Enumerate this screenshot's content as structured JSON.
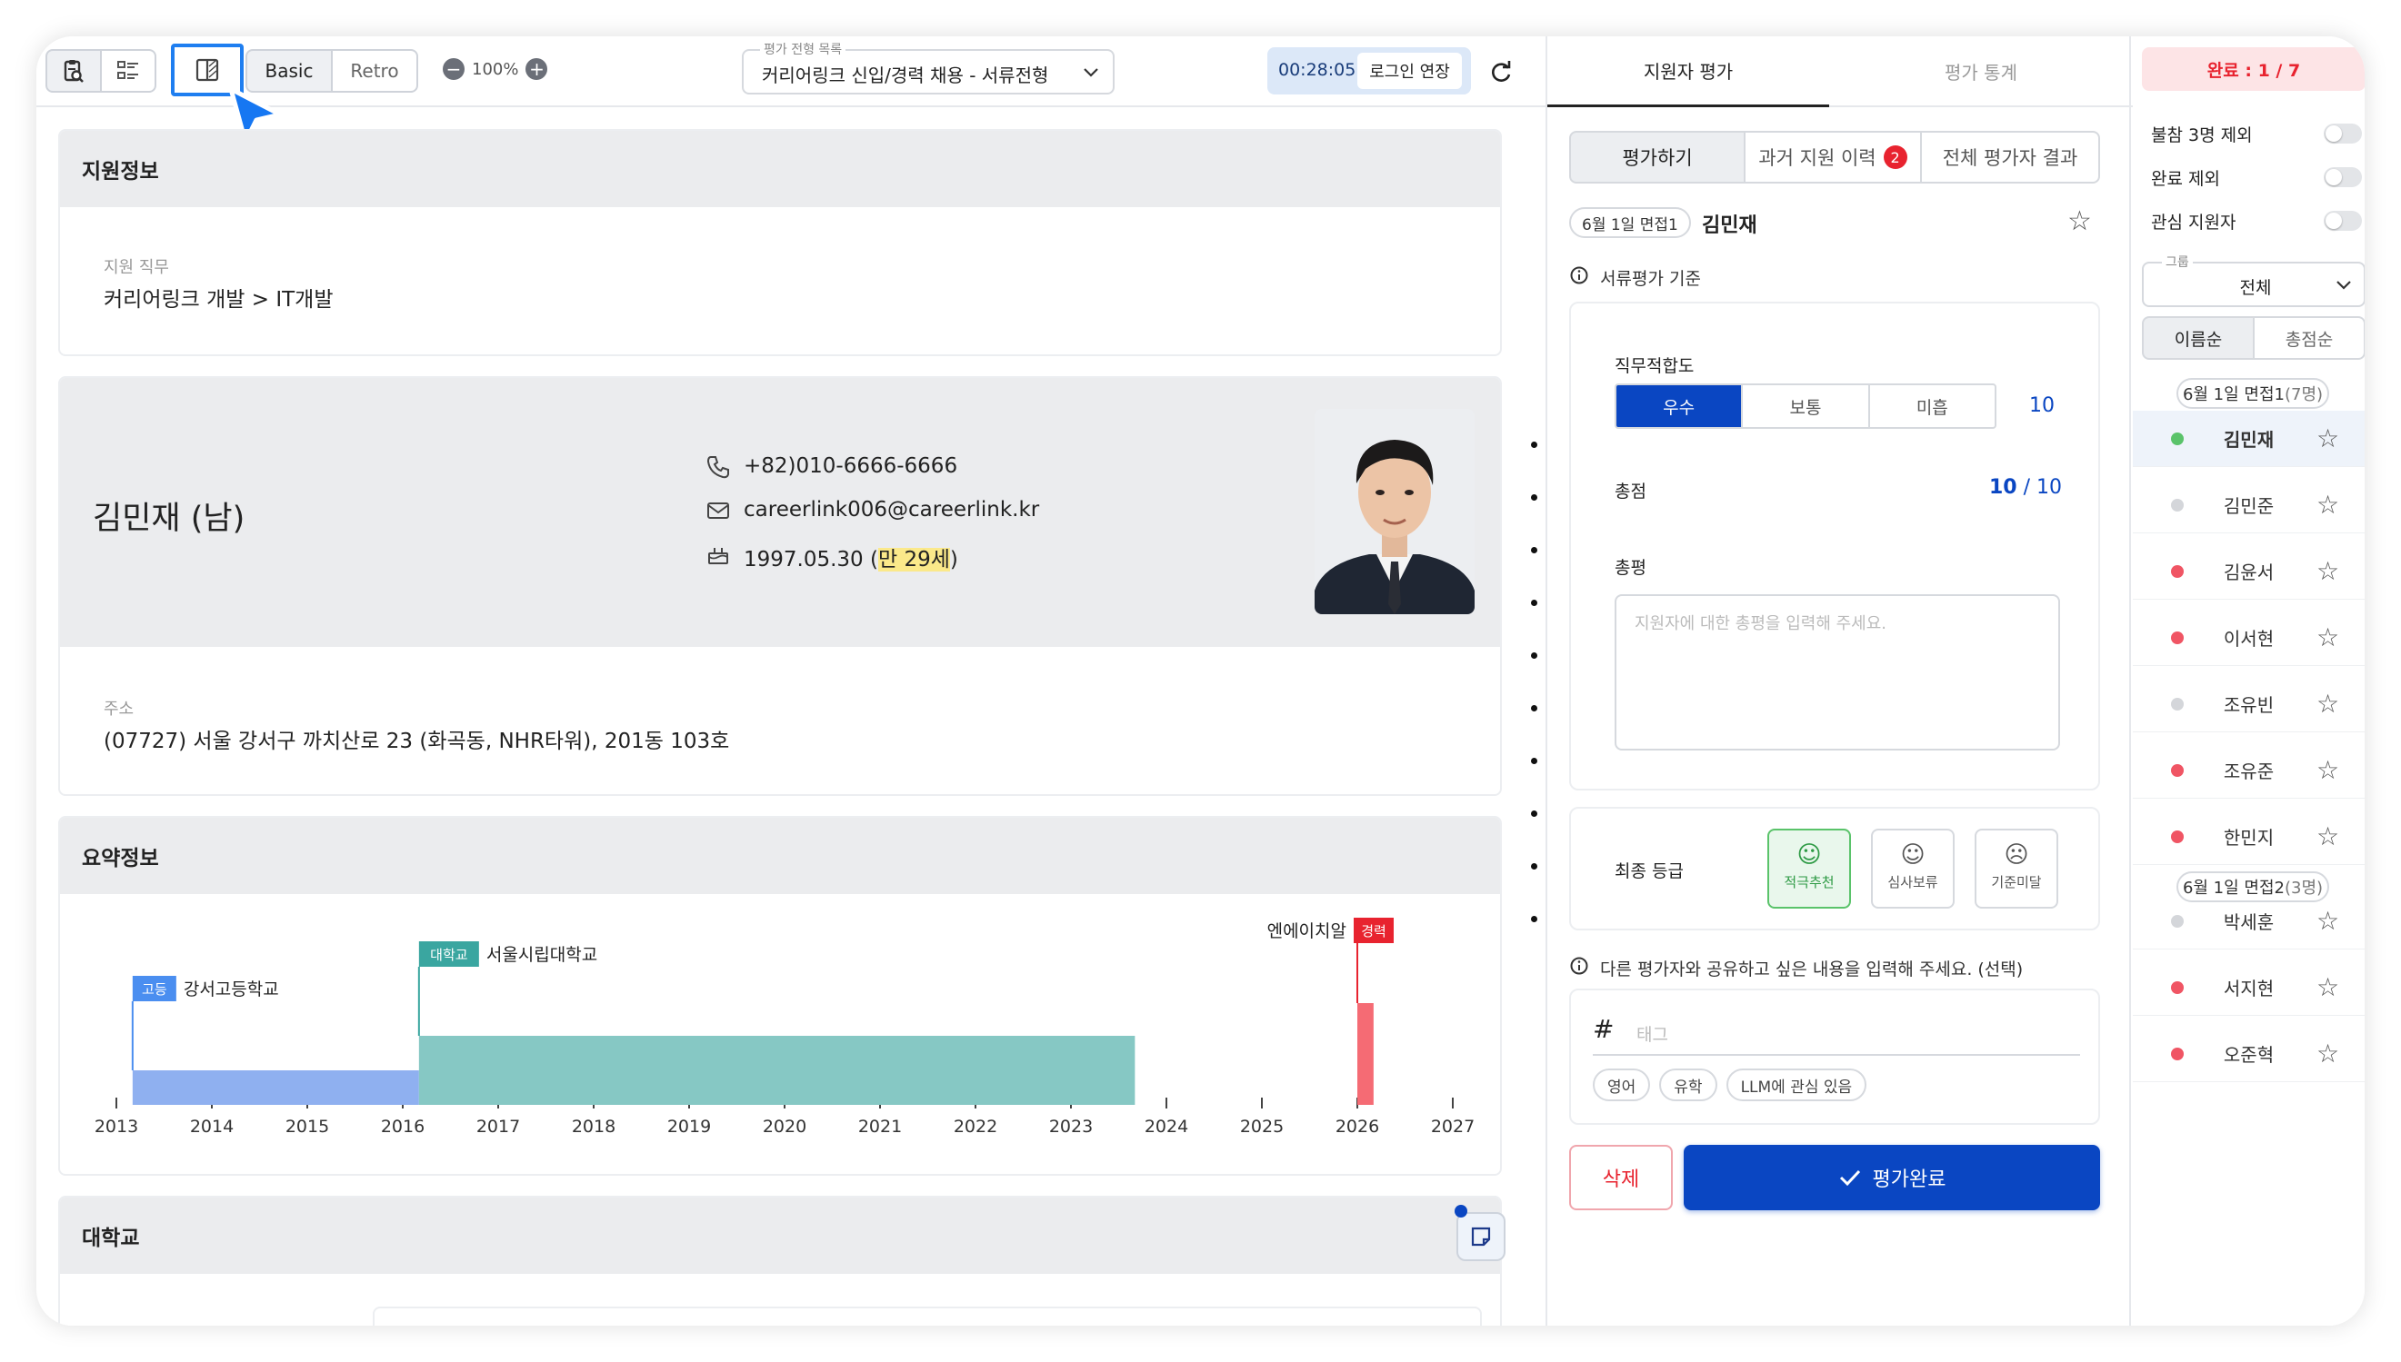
{
  "toolbar": {
    "layout_buttons": [
      "clipboard-search-icon",
      "list-grid-icon",
      "split-view-icon"
    ],
    "style_basic": "Basic",
    "style_retro": "Retro",
    "zoom_minus": "−",
    "zoom_level": "100%",
    "zoom_plus": "+",
    "select_caption": "평가 전형 목록",
    "select_value": "커리어링크 신입/경력 채용 - 서류전형",
    "timer": "00:28:05",
    "extend_login": "로그인 연장",
    "refresh_icon": "refresh-icon"
  },
  "applicant_info": {
    "title": "지원정보",
    "job_label": "지원 직무",
    "job_value": "커리어링크 개발 > IT개발"
  },
  "profile": {
    "name": "김민재 (남)",
    "phone": "+82)010-6666-6666",
    "email": "careerlink006@careerlink.kr",
    "birth_prefix": "1997.05.30 (",
    "age": "만 29세",
    "birth_suffix": ")",
    "address_label": "주소",
    "address": "(07727) 서울 강서구 까치산로 23 (화곡동, NHR타워), 201동 103호"
  },
  "summary": {
    "title": "요약정보"
  },
  "chart_data": {
    "type": "timeline",
    "x_ticks": [
      "2013",
      "2014",
      "2015",
      "2016",
      "2017",
      "2018",
      "2019",
      "2020",
      "2021",
      "2022",
      "2023",
      "2024",
      "2025",
      "2026",
      "2027"
    ],
    "xlim": [
      2013,
      2027
    ],
    "bars": [
      {
        "badge": "고등",
        "label": "강서고등학교",
        "start": 2013.17,
        "end": 2016.17,
        "color": "#8fb0f0",
        "badge_color": "#4a8ef0"
      },
      {
        "badge": "대학교",
        "label": "서울시립대학교",
        "start": 2016.17,
        "end": 2023.67,
        "color": "#86c8c4",
        "badge_color": "#3aa6a0"
      },
      {
        "badge": "경력",
        "label": "엔에이치알",
        "start": 2026.0,
        "end": 2026.17,
        "color": "#f56b74",
        "badge_color": "#e8232f"
      }
    ]
  },
  "university": {
    "title": "대학교"
  },
  "eval_panel": {
    "tab_eval": "지원자 평가",
    "tab_stats": "평가 통계",
    "seg_do": "평가하기",
    "seg_history": "과거 지원 이력",
    "history_count": "2",
    "seg_all": "전체 평가자 결과",
    "interview_chip": "6월 1일 면접1",
    "applicant_name": "김민재",
    "criteria_label": "서류평가 기준",
    "fit_label": "직무적합도",
    "fit_options": [
      "우수",
      "보통",
      "미흡"
    ],
    "fit_selected": "우수",
    "fit_score": "10",
    "total_label": "총점",
    "total_score": "10",
    "total_max": " / 10",
    "comment_label": "총평",
    "comment_placeholder": "지원자에 대한 총평을 입력해 주세요.",
    "grade_label": "최종 등급",
    "grades": [
      "적극추천",
      "심사보류",
      "기준미달"
    ],
    "grade_selected": "적극추천",
    "share_label": "다른 평가자와 공유하고 싶은 내용을 입력해 주세요. (선택)",
    "tag_placeholder": "태그",
    "tags": [
      "영어",
      "유학",
      "LLM에 관심 있음"
    ],
    "delete": "삭제",
    "complete": "평가완료"
  },
  "list_panel": {
    "status": "완료 : 1 / 7",
    "filters": [
      "불참 3명 제외",
      "완료 제외",
      "관심 지원자"
    ],
    "group_caption": "그룹",
    "group_value": "전체",
    "sort_name": "이름순",
    "sort_score": "총점순",
    "groups": [
      {
        "label": "6월 1일 면접1",
        "count": " (7명)",
        "items": [
          {
            "name": "김민재",
            "dot": "#5ac36a",
            "active": true
          },
          {
            "name": "김민준",
            "dot": "#d4d6da"
          },
          {
            "name": "김윤서",
            "dot": "#f05564"
          },
          {
            "name": "이서현",
            "dot": "#f05564"
          },
          {
            "name": "조유빈",
            "dot": "#d4d6da"
          },
          {
            "name": "조유준",
            "dot": "#f05564"
          },
          {
            "name": "한민지",
            "dot": "#f05564"
          }
        ]
      },
      {
        "label": "6월 1일 면접2",
        "count": " (3명)",
        "items": [
          {
            "name": "박세훈",
            "dot": "#d4d6da"
          },
          {
            "name": "서지현",
            "dot": "#f05564"
          },
          {
            "name": "오준혁",
            "dot": "#f05564"
          }
        ]
      }
    ]
  }
}
